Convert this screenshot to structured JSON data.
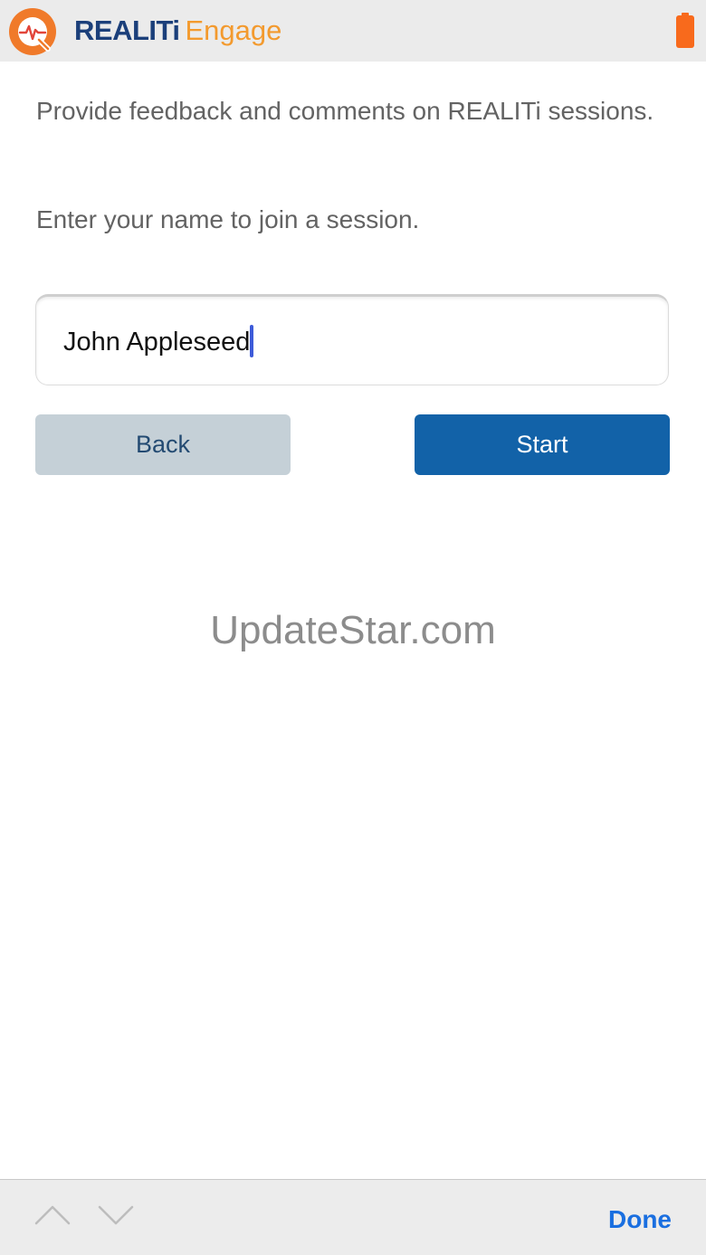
{
  "header": {
    "brand_main": "REALITi",
    "brand_sub": "Engage",
    "logo_icon": "realiti-q-logo-icon",
    "battery_icon": "battery-icon",
    "colors": {
      "brand_main": "#1b3f7a",
      "brand_sub": "#f39a2e",
      "logo_orange": "#f07a2a",
      "battery": "#f86a1c"
    }
  },
  "main": {
    "intro": "Provide feedback and comments on REALITi sessions.",
    "prompt": "Enter your name to join a session.",
    "name_input": {
      "value": "John Appleseed"
    },
    "back_label": "Back",
    "start_label": "Start",
    "colors": {
      "back_bg": "#c5d0d7",
      "start_bg": "#1262a8"
    }
  },
  "watermark": {
    "text": "UpdateStar.com"
  },
  "accessory_bar": {
    "up_icon": "chevron-up-icon",
    "down_icon": "chevron-down-icon",
    "done_label": "Done",
    "done_color": "#1a6fe0"
  }
}
